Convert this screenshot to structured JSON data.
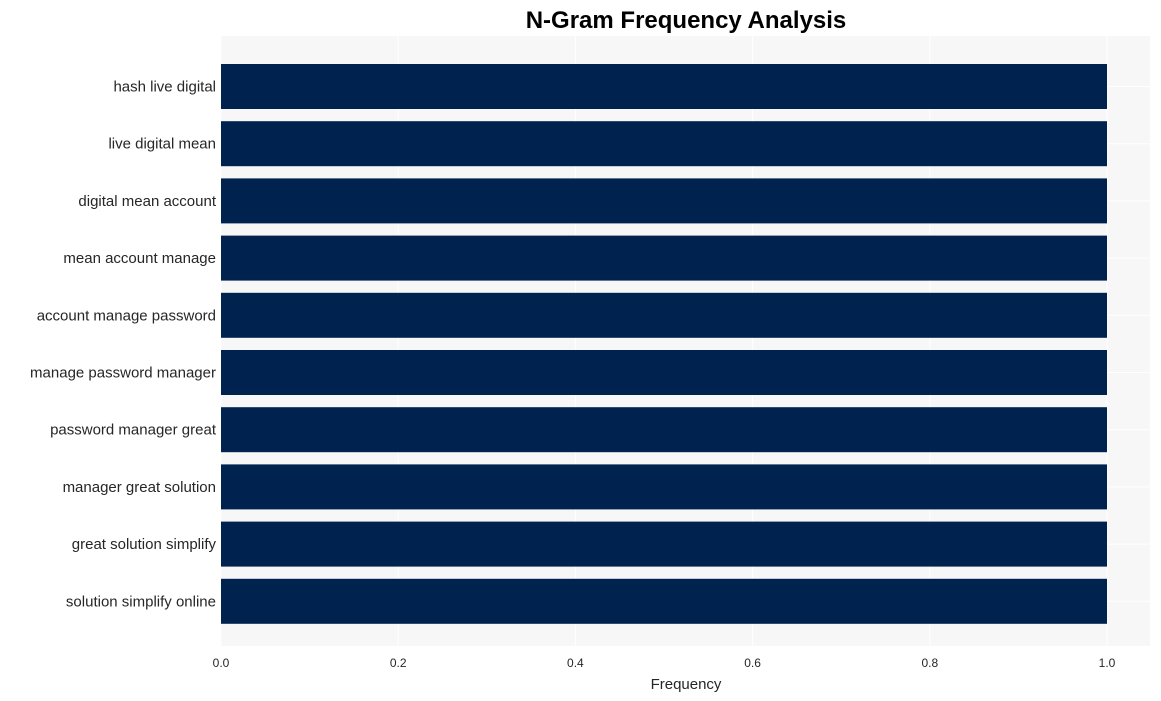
{
  "chart_data": {
    "type": "bar",
    "orientation": "horizontal",
    "title": "N-Gram Frequency Analysis",
    "xlabel": "Frequency",
    "ylabel": "",
    "xlim": [
      0,
      1.05
    ],
    "xticks": [
      "0.0",
      "0.2",
      "0.4",
      "0.6",
      "0.8",
      "1.0"
    ],
    "grid": true,
    "categories": [
      "hash live digital",
      "live digital mean",
      "digital mean account",
      "mean account manage",
      "account manage password",
      "manage password manager",
      "password manager great",
      "manager great solution",
      "great solution simplify",
      "solution simplify online"
    ],
    "values": [
      1,
      1,
      1,
      1,
      1,
      1,
      1,
      1,
      1,
      1
    ],
    "colors": {
      "bar": "#00224e",
      "plot_bg": "#f7f7f7",
      "grid": "#ffffff"
    }
  }
}
